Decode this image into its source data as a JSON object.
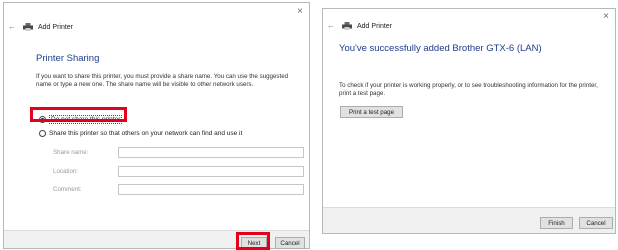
{
  "left_window": {
    "title": "Add Printer",
    "heading": "Printer Sharing",
    "description": "If you want to share this printer, you must provide a share name. You can use the suggested name or type a new one. The share name will be visible to other network users.",
    "radio_no_share": "Do not share this printer",
    "radio_share": "Share this printer so that others on your network can find and use it",
    "fields": [
      {
        "label": "Share name:",
        "value": ""
      },
      {
        "label": "Location:",
        "value": ""
      },
      {
        "label": "Comment:",
        "value": ""
      }
    ],
    "next_label": "Next",
    "cancel_label": "Cancel",
    "close_glyph": "×",
    "back_glyph": "←"
  },
  "right_window": {
    "title": "Add Printer",
    "heading": "You've successfully added Brother GTX-6 (LAN)",
    "description": "To check if your printer is working properly, or to see troubleshooting information for the printer, print a test page.",
    "test_page_label": "Print a test page",
    "finish_label": "Finish",
    "cancel_label": "Cancel",
    "close_glyph": "×",
    "back_glyph": "←"
  },
  "colors": {
    "heading": "#1e3c8c",
    "highlight": "#e4001b",
    "footer": "#f0f0f0"
  },
  "icons": [
    "close-icon",
    "back-arrow-icon",
    "printer-icon"
  ]
}
